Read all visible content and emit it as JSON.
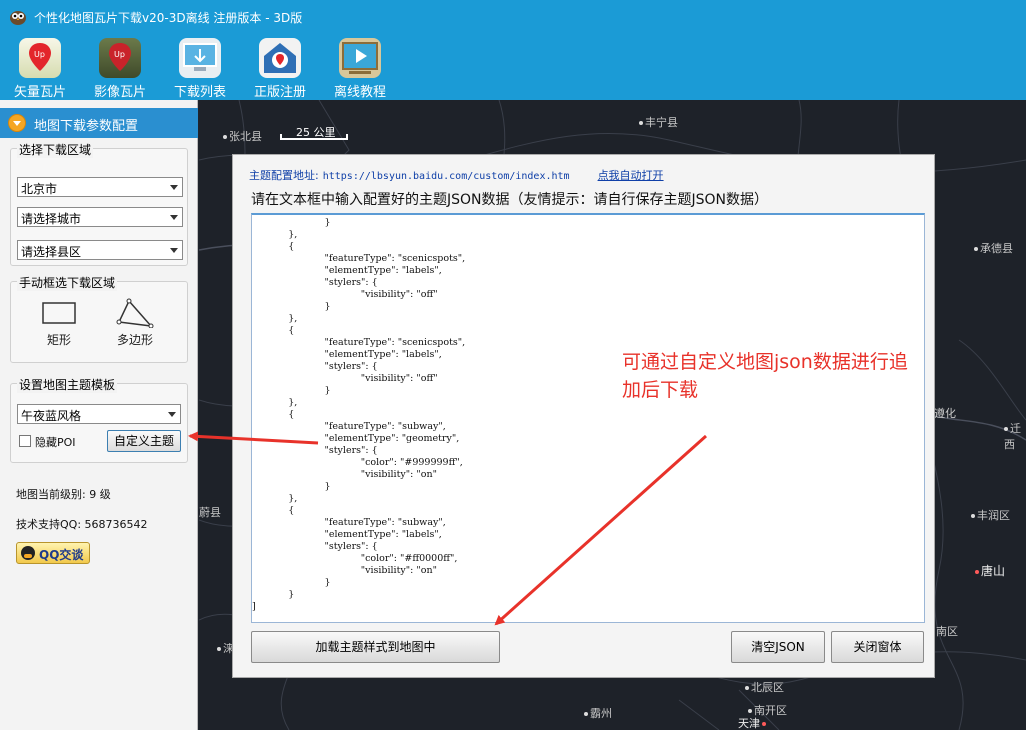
{
  "window": {
    "title": "个性化地图瓦片下载v20-3D离线  注册版本 - 3D版",
    "icon": "owl-app-icon"
  },
  "toolbar": {
    "items": [
      {
        "label": "矢量瓦片",
        "icon": "vector-tile-icon",
        "active": true
      },
      {
        "label": "影像瓦片",
        "icon": "image-tile-icon",
        "active": false
      },
      {
        "label": "下载列表",
        "icon": "download-list-icon",
        "active": false
      },
      {
        "label": "正版注册",
        "icon": "register-icon",
        "active": false
      },
      {
        "label": "离线教程",
        "icon": "tutorial-play-icon",
        "active": false
      }
    ]
  },
  "sidebar": {
    "header": "地图下载参数配置",
    "region_group": {
      "legend": "选择下载区域",
      "province": "北京市",
      "city": "请选择城市",
      "district": "请选择县区"
    },
    "manual_group": {
      "legend": "手动框选下载区域",
      "rect_label": "矩形",
      "polygon_label": "多边形"
    },
    "theme_group": {
      "legend": "设置地图主题模板",
      "theme": "午夜蓝风格",
      "hide_poi_label": "隐藏POI",
      "hide_poi_checked": false,
      "custom_theme_button": "自定义主题"
    },
    "zoom_level": "地图当前级别: 9 级",
    "support_qq": "技术支持QQ: 568736542",
    "qq_button": "QQ交谈"
  },
  "map": {
    "scale": "25 公里",
    "places": [
      {
        "name": "张北县"
      },
      {
        "name": "丰宁县"
      },
      {
        "name": "承德县"
      },
      {
        "name": "遵化"
      },
      {
        "name": "迁西"
      },
      {
        "name": "丰润区"
      },
      {
        "name": "唐山"
      },
      {
        "name": "南区"
      },
      {
        "name": "北辰区"
      },
      {
        "name": "霸州"
      },
      {
        "name": "南开区"
      },
      {
        "name": "天津"
      },
      {
        "name": "蔚县"
      },
      {
        "name": "涞"
      }
    ]
  },
  "dialog": {
    "config_label": "主题配置地址:",
    "config_url": "https://lbsyun.baidu.com/custom/index.htm",
    "open_link": "点我自动打开",
    "hint": "请在文本框中输入配置好的主题JSON数据（友情提示：请自行保存主题JSON数据）",
    "json_text": "                        }\n            },\n            {\n                        \"featureType\": \"scenicspots\",\n                        \"elementType\": \"labels\",\n                        \"stylers\": {\n                                    \"visibility\": \"off\"\n                        }\n            },\n            {\n                        \"featureType\": \"scenicspots\",\n                        \"elementType\": \"labels\",\n                        \"stylers\": {\n                                    \"visibility\": \"off\"\n                        }\n            },\n            {\n                        \"featureType\": \"subway\",\n                        \"elementType\": \"geometry\",\n                        \"stylers\": {\n                                    \"color\": \"#999999ff\",\n                                    \"visibility\": \"on\"\n                        }\n            },\n            {\n                        \"featureType\": \"subway\",\n                        \"elementType\": \"labels\",\n                        \"stylers\": {\n                                    \"color\": \"#ff0000ff\",\n                                    \"visibility\": \"on\"\n                        }\n            }\n]",
    "load_button": "加载主题样式到地图中",
    "clear_button": "清空JSON",
    "close_button": "关闭窗体"
  },
  "annotation": {
    "text": "可通过自定义地图json数据进行追加后下载",
    "color": "#e8322a"
  },
  "colors": {
    "titlebar": "#1b9bd6",
    "sidebar_header": "#2a8fd0",
    "map_background": "#1e2229"
  }
}
